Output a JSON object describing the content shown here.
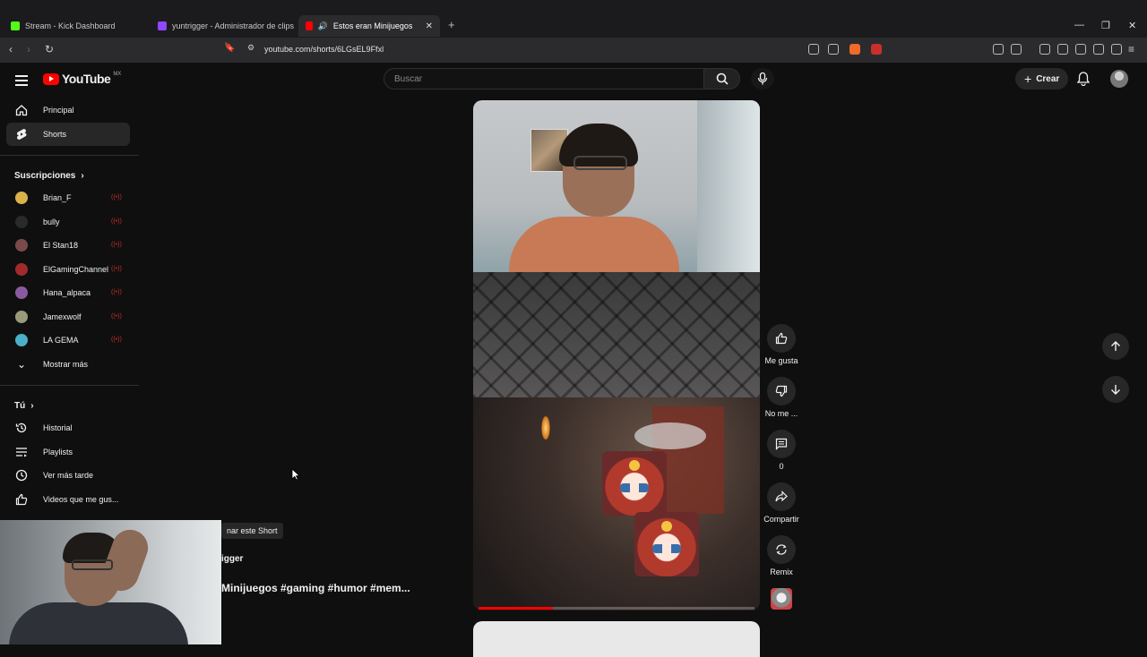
{
  "browser": {
    "tabs": [
      {
        "title": "Stream - Kick Dashboard",
        "color": "#53fc18"
      },
      {
        "title": "yuntrigger - Administrador de clips",
        "color": "#9146ff"
      },
      {
        "title": "Estos eran Minijuegos #gami",
        "color": "#ff0000"
      }
    ],
    "url": "youtube.com/shorts/6LGsEL9Ffxl"
  },
  "youtube": {
    "logo_text": "YouTube",
    "region": "MX",
    "search_placeholder": "Buscar",
    "create_label": "Crear"
  },
  "sidebar": {
    "main": [
      {
        "label": "Principal",
        "icon": "home-icon"
      },
      {
        "label": "Shorts",
        "icon": "shorts-icon"
      }
    ],
    "subs_header": "Suscripciones",
    "subscriptions": [
      {
        "label": "Brian_F",
        "color": "#d9b34a"
      },
      {
        "label": "bully",
        "color": "#2a2a2a"
      },
      {
        "label": "El Stan18",
        "color": "#7a4a4a"
      },
      {
        "label": "ElGamingChannel",
        "color": "#a22a2a"
      },
      {
        "label": "Hana_alpaca",
        "color": "#8a5aa0"
      },
      {
        "label": "Jamexwolf",
        "color": "#9a9a7a"
      },
      {
        "label": "LA GEMA",
        "color": "#4ab0c8"
      }
    ],
    "show_more": "Mostrar más",
    "you_header": "Tú",
    "you": [
      {
        "label": "Historial",
        "icon": "history-icon"
      },
      {
        "label": "Playlists",
        "icon": "playlist-icon"
      },
      {
        "label": "Ver más tarde",
        "icon": "clock-icon"
      },
      {
        "label": "Videos que me gus...",
        "icon": "thumb-up-icon"
      }
    ]
  },
  "short": {
    "progress_pct": 27,
    "actions": {
      "like": "Me gusta",
      "dislike": "No me ...",
      "comments": "0",
      "share": "Compartir",
      "remix": "Remix"
    },
    "chip": "nar este Short",
    "channel": "igger",
    "title": "Minijuegos  #gaming #humor #mem..."
  }
}
